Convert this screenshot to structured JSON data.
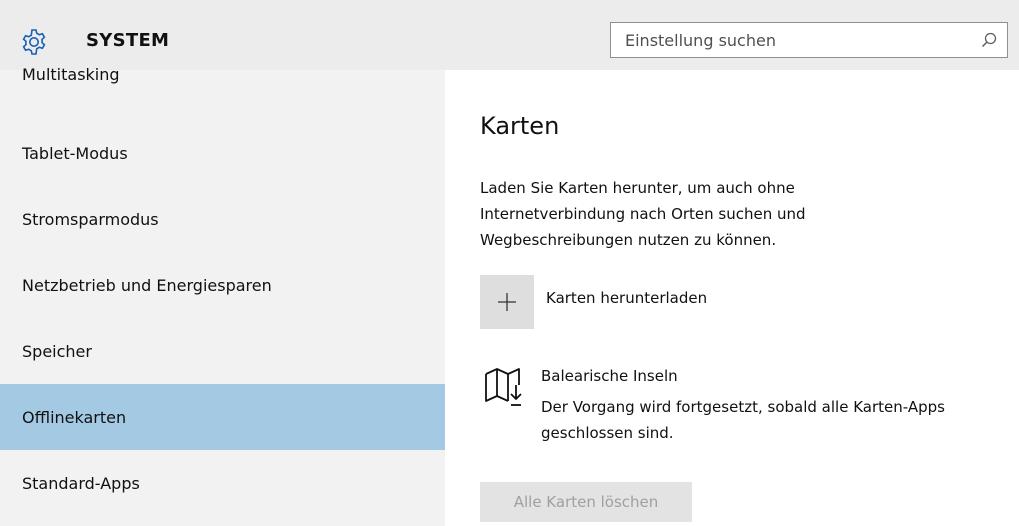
{
  "header": {
    "title": "SYSTEM",
    "icon": "gear-icon",
    "search": {
      "placeholder": "Einstellung suchen",
      "icon": "search-icon"
    }
  },
  "sidebar": {
    "items": [
      {
        "label": "Multitasking",
        "selected": false
      },
      {
        "label": "Tablet-Modus",
        "selected": false
      },
      {
        "label": "Stromsparmodus",
        "selected": false
      },
      {
        "label": "Netzbetrieb und Energiesparen",
        "selected": false
      },
      {
        "label": "Speicher",
        "selected": false
      },
      {
        "label": "Offlinekarten",
        "selected": true
      },
      {
        "label": "Standard-Apps",
        "selected": false
      }
    ],
    "selected_color": "#a4cae3"
  },
  "main": {
    "title": "Karten",
    "description": "Laden Sie Karten herunter, um auch ohne Internetverbindung nach Orten suchen und Wegbeschreibungen nutzen zu können.",
    "add_button": {
      "icon": "plus-icon",
      "label": "Karten herunterladen"
    },
    "download": {
      "icon": "map-download-icon",
      "name": "Balearische Inseln",
      "status": "Der Vorgang wird fortgesetzt, sobald alle Karten-Apps geschlossen sind."
    },
    "delete_button": {
      "label": "Alle Karten löschen",
      "disabled": true
    }
  }
}
